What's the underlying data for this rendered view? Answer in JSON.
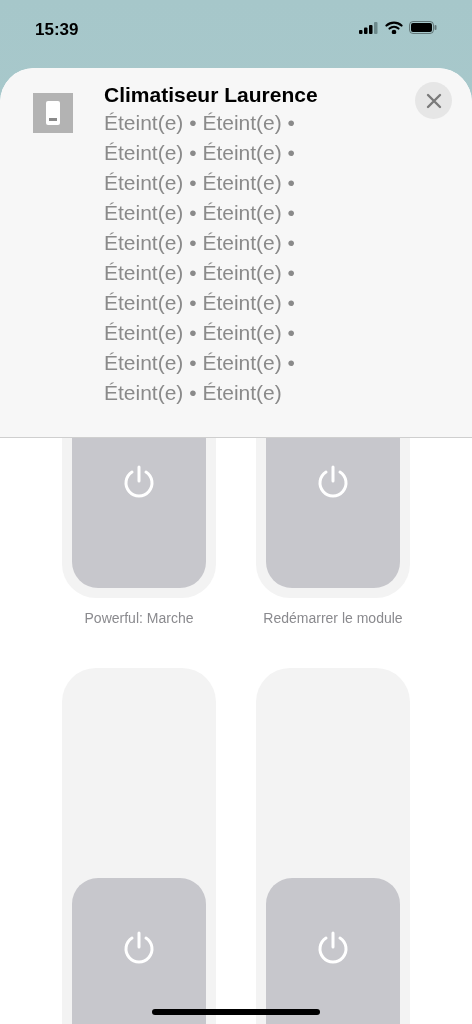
{
  "status_bar": {
    "time": "15:39"
  },
  "header": {
    "title": "Climatiseur Laurence",
    "status": "Éteint(e) • Éteint(e) • Éteint(e) • Éteint(e) • Éteint(e) • Éteint(e) • Éteint(e) • Éteint(e) • Éteint(e) • Éteint(e) • Éteint(e) • Éteint(e) • Éteint(e) • Éteint(e) • Éteint(e) • Éteint(e) • Éteint(e) • Éteint(e) • Éteint(e) • Éteint(e)"
  },
  "tiles": [
    {
      "label": "Powerful: Marche",
      "on": false
    },
    {
      "label": "Redémarrer le module",
      "on": false
    },
    {
      "on": false
    },
    {
      "on": false
    }
  ]
}
